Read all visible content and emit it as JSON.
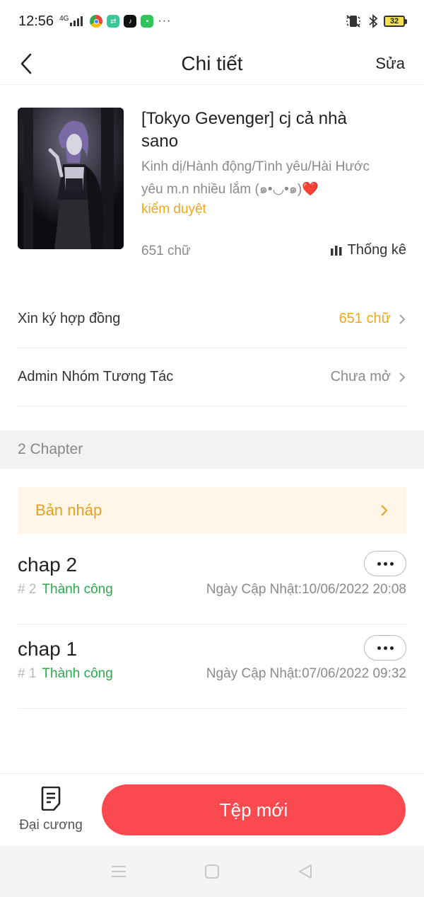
{
  "status_bar": {
    "time": "12:56",
    "network": "4G",
    "battery": "32",
    "icons": [
      "signal-icon",
      "chrome-icon",
      "app-green-icon",
      "tiktok-icon",
      "messages-icon",
      "more-dots-icon",
      "mute-icon",
      "bluetooth-icon",
      "battery-icon"
    ]
  },
  "header": {
    "title": "Chi tiết",
    "edit_label": "Sửa"
  },
  "book": {
    "title": "[Tokyo Gevenger] cj cả nhà sano",
    "genres": "Kinh dị/Hành động/Tình yêu/Hài Hước",
    "description": "yêu m.n nhiều lắm (๑•◡•๑)❤️",
    "review_status": "kiểm duyệt",
    "word_count": "651 chữ",
    "stats_label": "Thống kê",
    "accent_color": "#f0a818"
  },
  "settings": [
    {
      "label": "Xin ký hợp đồng",
      "value": "651 chữ",
      "value_color": "#f0a818"
    },
    {
      "label": "Admin Nhóm Tương Tác",
      "value": "Chưa mở",
      "value_color": "#8a8a8a"
    }
  ],
  "chapters_section": {
    "count_label": "2 Chapter",
    "draft_label": "Bản nháp",
    "items": [
      {
        "title": "chap 2",
        "number": "# 2",
        "status": "Thành công",
        "updated": "Ngày Cập Nhật:10/06/2022 20:08"
      },
      {
        "title": "chap 1",
        "number": "# 1",
        "status": "Thành công",
        "updated": "Ngày Cập Nhật:07/06/2022 09:32"
      }
    ]
  },
  "bottom_bar": {
    "outline_label": "Đại cương",
    "new_file_label": "Tệp mới",
    "button_color": "#fb4a4f"
  },
  "system_nav": [
    "menu-icon",
    "home-icon",
    "back-triangle-icon"
  ]
}
